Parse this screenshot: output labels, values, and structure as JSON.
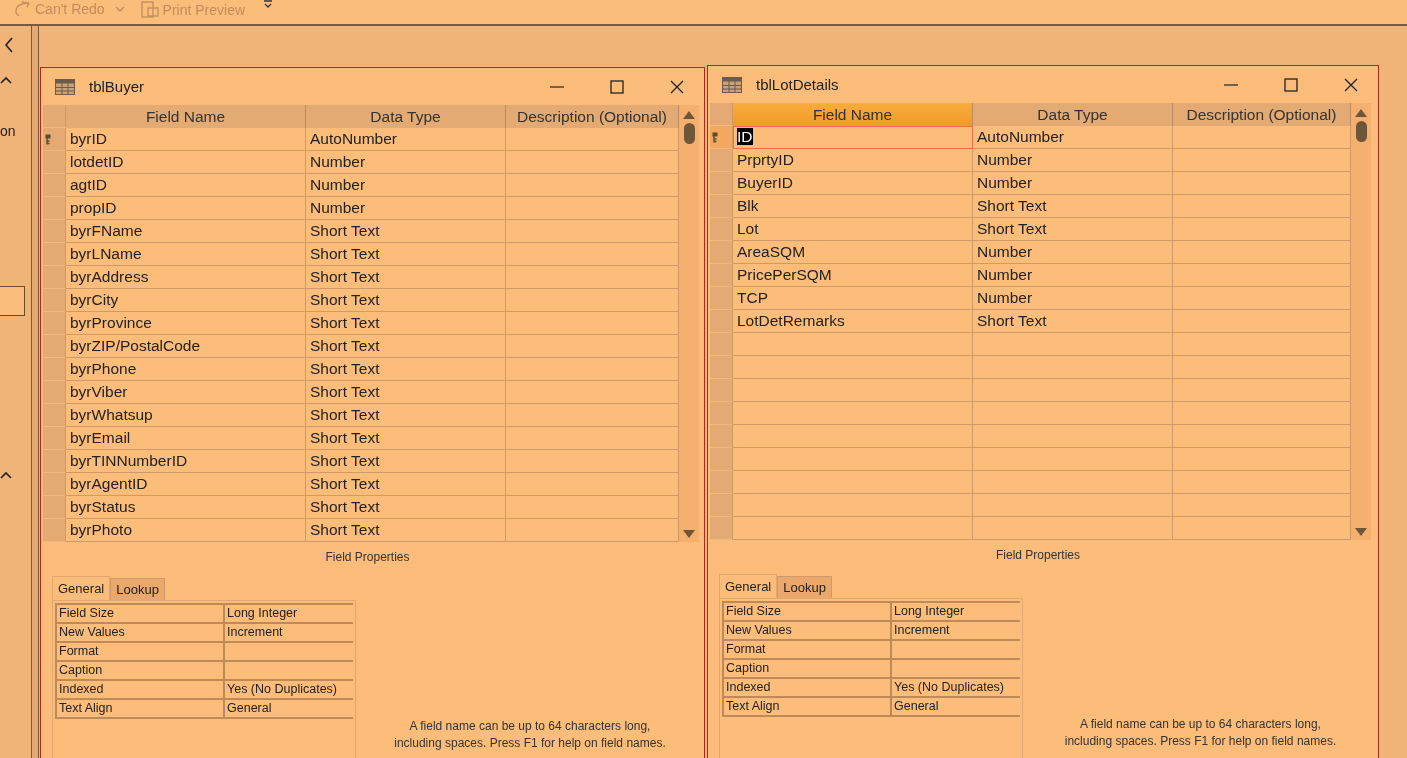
{
  "toolbar": {
    "items": [
      {
        "label": "Can't Redo",
        "kind": "redo",
        "disabled": true
      },
      {
        "label": "Print Preview",
        "kind": "print",
        "disabled": true
      }
    ]
  },
  "nav_pane": {
    "partial_label": "on"
  },
  "windows": [
    {
      "title": "tblBuyer",
      "columns": [
        {
          "label": "Field Name",
          "selected": false
        },
        {
          "label": "Data Type",
          "selected": false
        },
        {
          "label": "Description (Optional)",
          "selected": false
        }
      ],
      "rows": [
        {
          "field_name": "byrID",
          "data_type": "AutoNumber",
          "primary_key": true,
          "selected": false
        },
        {
          "field_name": "lotdetID",
          "data_type": "Number",
          "primary_key": false,
          "selected": false
        },
        {
          "field_name": "agtID",
          "data_type": "Number",
          "primary_key": false,
          "selected": false
        },
        {
          "field_name": "propID",
          "data_type": "Number",
          "primary_key": false,
          "selected": false
        },
        {
          "field_name": "byrFName",
          "data_type": "Short Text",
          "primary_key": false,
          "selected": false
        },
        {
          "field_name": "byrLName",
          "data_type": "Short Text",
          "primary_key": false,
          "selected": false
        },
        {
          "field_name": "byrAddress",
          "data_type": "Short Text",
          "primary_key": false,
          "selected": false
        },
        {
          "field_name": "byrCity",
          "data_type": "Short Text",
          "primary_key": false,
          "selected": false
        },
        {
          "field_name": "byrProvince",
          "data_type": "Short Text",
          "primary_key": false,
          "selected": false
        },
        {
          "field_name": "byrZIP/PostalCode",
          "data_type": "Short Text",
          "primary_key": false,
          "selected": false
        },
        {
          "field_name": "byrPhone",
          "data_type": "Short Text",
          "primary_key": false,
          "selected": false
        },
        {
          "field_name": "byrViber",
          "data_type": "Short Text",
          "primary_key": false,
          "selected": false
        },
        {
          "field_name": "byrWhatsup",
          "data_type": "Short Text",
          "primary_key": false,
          "selected": false
        },
        {
          "field_name": "byrEmail",
          "data_type": "Short Text",
          "primary_key": false,
          "selected": false
        },
        {
          "field_name": "byrTINNumberID",
          "data_type": "Short Text",
          "primary_key": false,
          "selected": false
        },
        {
          "field_name": "byrAgentID",
          "data_type": "Short Text",
          "primary_key": false,
          "selected": false
        },
        {
          "field_name": "byrStatus",
          "data_type": "Short Text",
          "primary_key": false,
          "selected": false
        },
        {
          "field_name": "byrPhoto",
          "data_type": "Short Text",
          "primary_key": false,
          "selected": false
        }
      ],
      "field_properties_label": "Field Properties",
      "tabs": [
        {
          "label": "General",
          "selected": true
        },
        {
          "label": "Lookup",
          "selected": false
        }
      ],
      "properties": [
        {
          "label": "Field Size",
          "value": "Long Integer"
        },
        {
          "label": "New Values",
          "value": "Increment"
        },
        {
          "label": "Format"
        },
        {
          "label": "Caption"
        },
        {
          "label": "Indexed",
          "value": "Yes (No Duplicates)"
        },
        {
          "label": "Text Align",
          "value": "General"
        }
      ],
      "help_text": "A field name can be up to 64 characters long, including spaces. Press F1 for help on field names."
    },
    {
      "title": "tblLotDetails",
      "columns": [
        {
          "label": "Field Name",
          "selected": true
        },
        {
          "label": "Data Type",
          "selected": false
        },
        {
          "label": "Description (Optional)",
          "selected": false
        }
      ],
      "rows": [
        {
          "field_name": "ID",
          "data_type": "AutoNumber",
          "primary_key": true,
          "selected": true
        },
        {
          "field_name": "PrprtyID",
          "data_type": "Number",
          "primary_key": false,
          "selected": false
        },
        {
          "field_name": "BuyerID",
          "data_type": "Number",
          "primary_key": false,
          "selected": false
        },
        {
          "field_name": "Blk",
          "data_type": "Short Text",
          "primary_key": false,
          "selected": false
        },
        {
          "field_name": "Lot",
          "data_type": "Short Text",
          "primary_key": false,
          "selected": false
        },
        {
          "field_name": "AreaSQM",
          "data_type": "Number",
          "primary_key": false,
          "selected": false
        },
        {
          "field_name": "PricePerSQM",
          "data_type": "Number",
          "primary_key": false,
          "selected": false
        },
        {
          "field_name": "TCP",
          "data_type": "Number",
          "primary_key": false,
          "selected": false
        },
        {
          "field_name": "LotDetRemarks",
          "data_type": "Short Text",
          "primary_key": false,
          "selected": false
        }
      ],
      "field_properties_label": "Field Properties",
      "tabs": [
        {
          "label": "General",
          "selected": true
        },
        {
          "label": "Lookup",
          "selected": false
        }
      ],
      "properties": [
        {
          "label": "Field Size",
          "value": "Long Integer"
        },
        {
          "label": "New Values",
          "value": "Increment"
        },
        {
          "label": "Format"
        },
        {
          "label": "Caption"
        },
        {
          "label": "Indexed",
          "value": "Yes (No Duplicates)"
        },
        {
          "label": "Text Align",
          "value": "General"
        }
      ],
      "help_text": "A field name can be up to 64 characters long, including spaces. Press F1 for help on field names."
    }
  ]
}
